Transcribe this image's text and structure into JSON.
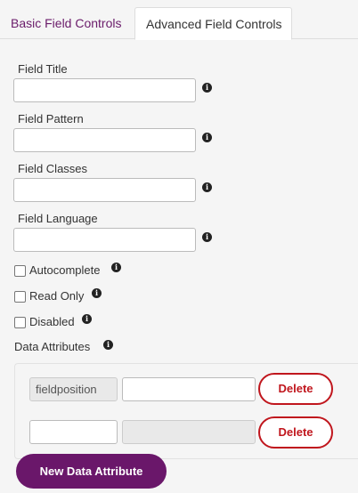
{
  "tabs": {
    "basic": "Basic Field Controls",
    "advanced": "Advanced Field Controls"
  },
  "fields": {
    "title": {
      "label": "Field Title",
      "value": ""
    },
    "pattern": {
      "label": "Field Pattern",
      "value": ""
    },
    "classes": {
      "label": "Field Classes",
      "value": ""
    },
    "language": {
      "label": "Field Language",
      "value": ""
    }
  },
  "checkboxes": {
    "autocomplete": {
      "label": "Autocomplete",
      "checked": false
    },
    "readonly": {
      "label": "Read Only",
      "checked": false
    },
    "disabled": {
      "label": "Disabled",
      "checked": false
    }
  },
  "data_attributes": {
    "label": "Data Attributes",
    "rows": [
      {
        "name": "fieldposition",
        "value": "",
        "delete_label": "Delete"
      },
      {
        "name": "",
        "value": "",
        "delete_label": "Delete"
      }
    ],
    "new_button": "New Data Attribute"
  },
  "icons": {
    "info": "info-icon"
  },
  "colors": {
    "accent": "#6a176a",
    "danger": "#c0161d",
    "tab_link": "#6a1b6a"
  }
}
